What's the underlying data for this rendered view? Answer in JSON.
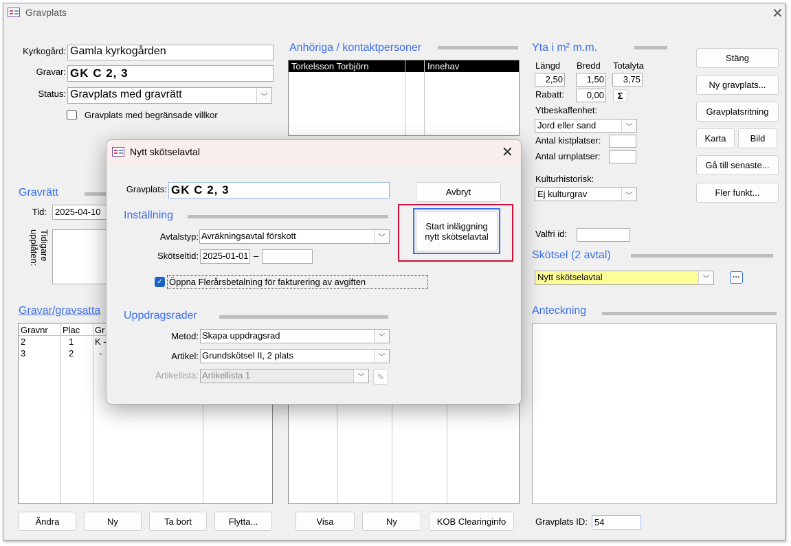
{
  "window": {
    "title": "Gravplats"
  },
  "main": {
    "kyrkogard_label": "Kyrkogård:",
    "kyrkogard_value": "Gamla kyrkogården",
    "gravar_label": "Gravar:",
    "gravar_value": "GK C    2, 3",
    "status_label": "Status:",
    "status_value": "Gravplats med gravrätt",
    "begransade_label": "Gravplats med begränsade villkor",
    "anhoriga_title": "Anhöriga / kontaktpersoner",
    "anhoriga_rows": [
      {
        "name": "Torkelsson Torbjörn",
        "col2": "",
        "role": "Innehav"
      }
    ],
    "gravratt_title": "Gravrätt",
    "tid_label": "Tid:",
    "tid_value": "2025-04-10",
    "tidigare_label": "Tidigare upplåten:",
    "gravar_gravsatta_title": "Gravar/gravsatta",
    "gravar_table": {
      "headers": [
        "Gravnr",
        "Plac",
        "Gr"
      ],
      "rows": [
        [
          "2",
          "1",
          "K -"
        ],
        [
          "3",
          "2",
          "-"
        ]
      ]
    },
    "yta_title": "Yta i m²  m.m.",
    "langd_label": "Längd",
    "bredd_label": "Bredd",
    "totalyta_label": "Totalyta",
    "langd_value": "2,50",
    "bredd_value": "1,50",
    "totalyta_value": "3,75",
    "rabatt_label": "Rabatt:",
    "rabatt_value": "0,00",
    "sum_label": "Σ",
    "ytbeskaffenhet_label": "Ytbeskaffenhet:",
    "ytbeskaffenhet_value": "Jord eller sand",
    "kistplatser_label": "Antal kistplatser:",
    "urnplatser_label": "Antal urnplatser:",
    "kulturhistorisk_label": "Kulturhistorisk:",
    "kulturhistorisk_value": "Ej kulturgrav",
    "valfri_label": "Valfri id:",
    "skotsel_title": "Skötsel (2 avtal)",
    "skotsel_value": "Nytt skötselavtal",
    "more_label": "···",
    "anteckning_title": "Anteckning",
    "gravplats_id_label": "Gravplats ID:",
    "gravplats_id_value": "54"
  },
  "side_buttons": {
    "stang": "Stäng",
    "ny_gravplats": "Ny gravplats...",
    "ritning": "Gravplatsritning",
    "karta": "Karta",
    "bild": "Bild",
    "ga_till": "Gå till senaste...",
    "fler": "Fler funkt..."
  },
  "bottom_buttons": {
    "andra": "Ändra",
    "ny1": "Ny",
    "ta_bort": "Ta bort",
    "flytta": "Flytta...",
    "visa": "Visa",
    "ny2": "Ny",
    "kob": "KOB Clearinginfo"
  },
  "dialog": {
    "title": "Nytt skötselavtal",
    "gravplats_label": "Gravplats:",
    "gravplats_value": "GK C    2, 3",
    "avbryt": "Avbryt",
    "start": "Start inläggning nytt skötselavtal",
    "installning_title": "Inställning",
    "avtalstyp_label": "Avtalstyp:",
    "avtalstyp_value": "Avräkningsavtal förskott",
    "skotseltid_label": "Skötseltid:",
    "skotseltid_from": "2025-01-01",
    "dash": "–",
    "oppna_label": "Öppna Flerårsbetalning för fakturering av avgiften",
    "uppdrag_title": "Uppdragsrader",
    "metod_label": "Metod:",
    "metod_value": "Skapa uppdragsrad",
    "artikel_label": "Artikel:",
    "artikel_value": "Grundskötsel II, 2 plats",
    "artikellista_label": "Artikellista:",
    "artikellista_value": "Artikellista 1"
  },
  "colors": {
    "accent": "#3a6ef0",
    "highlight_red": "#d0103a",
    "highlight_blue": "#3a6ef0",
    "yellow": "#ffff99"
  }
}
